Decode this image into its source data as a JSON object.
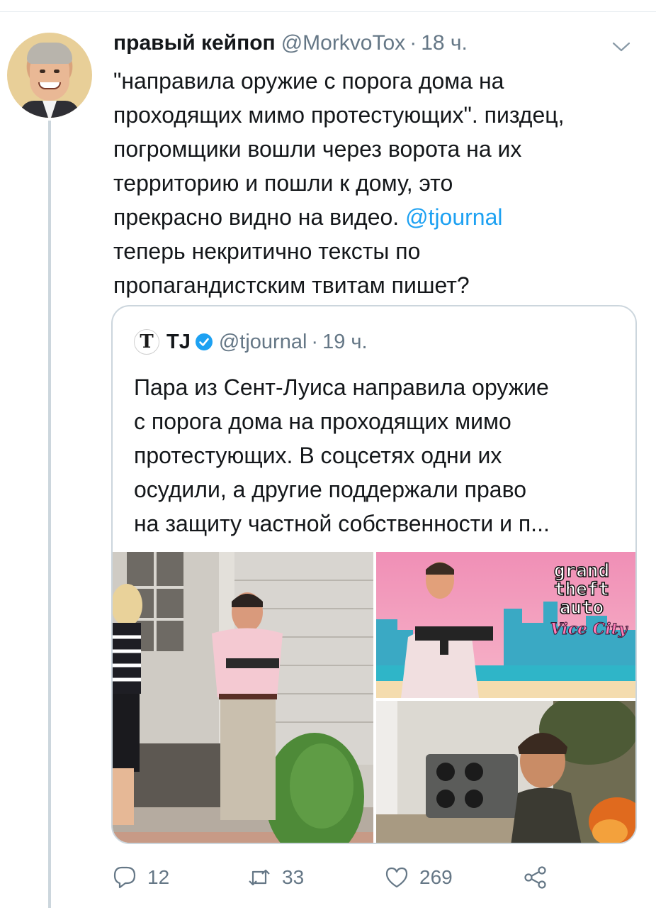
{
  "tweet": {
    "author_name": "правый кейпоп",
    "author_handle": "@MorkvoTox",
    "dot": "·",
    "time": "18 ч.",
    "text_lines": [
      "\"направила оружие с порога дома на",
      "проходящих мимо протестующих\". пиздец,",
      "погромщики вошли через ворота на их",
      "территорию и пошли к дому, это",
      "прекрасно видно на видео. ",
      "теперь некритично тексты по",
      "пропагандистским твитам пишет?"
    ],
    "mention": "@tjournal",
    "menu_icon": "chevron-down-icon",
    "accent_color": "#1da1f2"
  },
  "quoted": {
    "logo_letter": "T",
    "name": "TJ",
    "verified_icon": "verified-badge-icon",
    "handle": "@tjournal",
    "dot": "·",
    "time": "19 ч.",
    "text_lines": [
      "Пара из Сент-Луиса направила оружие",
      "с порога дома на проходящих мимо",
      "протестующих. В соцсетях одни их",
      "осудили, а другие поддержали право",
      "на защиту частной собственности и п..."
    ],
    "images": [
      {
        "name": "photo-couple-with-guns"
      },
      {
        "name": "gta-vice-city-meme",
        "logo_lines": [
          "grand",
          "theft",
          "auto"
        ],
        "logo_script": "Vice City"
      },
      {
        "name": "rocket-launcher-meme"
      }
    ]
  },
  "actions": {
    "reply": {
      "icon": "reply-icon",
      "count": "12"
    },
    "retweet": {
      "icon": "retweet-icon",
      "count": "33"
    },
    "like": {
      "icon": "heart-icon",
      "count": "269"
    },
    "share": {
      "icon": "share-icon",
      "count": ""
    }
  }
}
